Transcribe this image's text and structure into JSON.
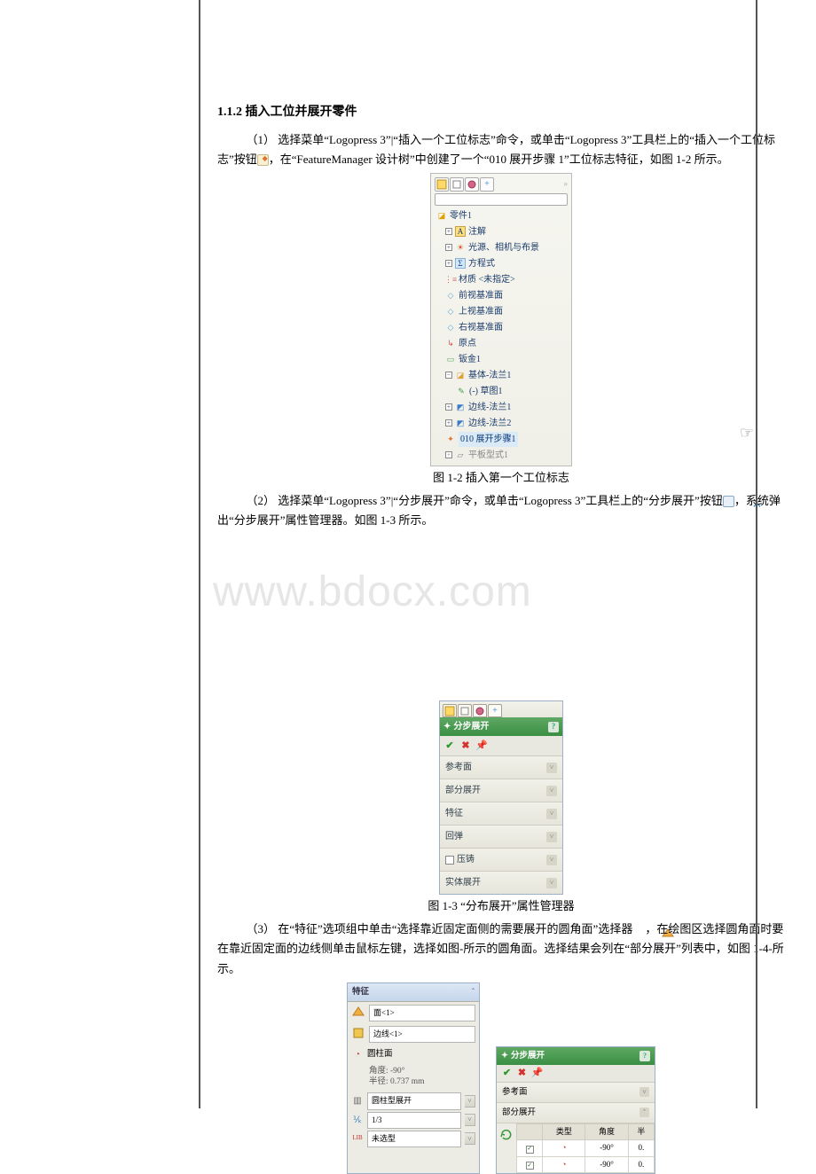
{
  "watermark": "www.bdocx.com",
  "annotation_glyph": "☞",
  "heading": "1.1.2 插入工位并展开零件",
  "para1_a": "（1）  选择菜单“Logopress 3”|“插入一个工位标志”命令，或单击“Logopress 3”工具栏上的“插入一个工位标志”按钮",
  "para1_b": "，在“FeatureManager 设计树”中创建了一个“010 展开步骤 1”工位标志特征，如图 1-2 所示。",
  "caption12": "图 1-2  插入第一个工位标志",
  "para2_a": "（2）  选择菜单“Logopress 3”|“分步展开”命令，或单击“Logopress 3”工具栏上的“分步展开”按钮",
  "para2_b": "，系统弹出“分步展开”属性管理器。如图 1-3 所示。",
  "caption13": "图 1-3  “分布展开”属性管理器",
  "para3_a": "（3）  在“特征”选项组中单击“选择靠近固定面侧的需要展开的圆角面”选择器",
  "para3_b": "，在绘图区选择圆角面时要在靠近固定面的边线侧单击鼠标左键，选择如图-所示的圆角面。选择结果会列在“部分展开”列表中，如图 1-4-所示。",
  "fig12": {
    "root": "零件1",
    "nodes": {
      "annot": "注解",
      "lights": "光源、相机与布景",
      "equation": "方程式",
      "material": "材质 <未指定>",
      "front": "前视基准面",
      "top": "上视基准面",
      "right": "右视基准面",
      "origin": "原点",
      "sheet": "钣金1",
      "base": "基体-法兰1",
      "sketch": "(-) 草图1",
      "edge1": "边线-法兰1",
      "edge2": "边线-法兰2",
      "step": "010 展开步骤1",
      "flat": "平板型式1"
    }
  },
  "fig13": {
    "title": "分步展开",
    "sections": {
      "ref": "参考面",
      "partial": "部分展开",
      "feature": "特征",
      "spring": "回弹",
      "impr": "压铸",
      "body": "实体展开"
    }
  },
  "fig14left": {
    "title": "特征",
    "face": "面<1>",
    "edge": "边线<1>",
    "cyl": "圆柱面",
    "angle": "角度: -90°",
    "radius": "半径: 0.737 mm",
    "method": "圆柱型展开",
    "ratio": "1/3",
    "model": "未选型"
  },
  "fig14right": {
    "title": "分步展开",
    "ref": "参考面",
    "partial": "部分展开",
    "table": {
      "h1": "类型",
      "h2": "角度",
      "h3": "半",
      "rows": [
        {
          "angle": "-90°",
          "r": "0."
        },
        {
          "angle": "-90°",
          "r": "0."
        }
      ]
    }
  }
}
